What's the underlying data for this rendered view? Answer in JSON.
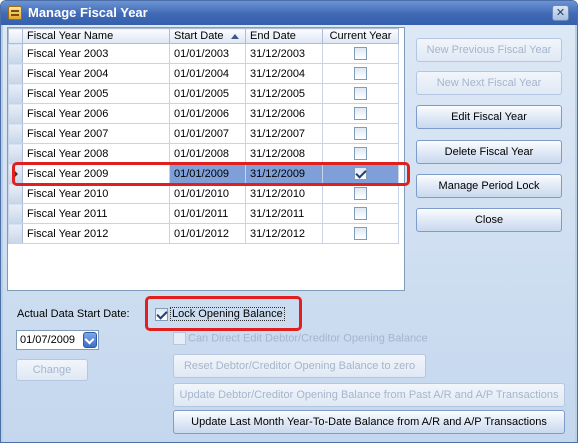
{
  "window": {
    "title": "Manage Fiscal Year",
    "close_glyph": "✕"
  },
  "grid": {
    "columns": [
      "Fiscal Year Name",
      "Start Date",
      "End Date",
      "Current Year"
    ],
    "rows": [
      {
        "name": "Fiscal Year 2003",
        "start": "01/01/2003",
        "end": "31/12/2003",
        "current": false
      },
      {
        "name": "Fiscal Year 2004",
        "start": "01/01/2004",
        "end": "31/12/2004",
        "current": false
      },
      {
        "name": "Fiscal Year 2005",
        "start": "01/01/2005",
        "end": "31/12/2005",
        "current": false
      },
      {
        "name": "Fiscal Year 2006",
        "start": "01/01/2006",
        "end": "31/12/2006",
        "current": false
      },
      {
        "name": "Fiscal Year 2007",
        "start": "01/01/2007",
        "end": "31/12/2007",
        "current": false
      },
      {
        "name": "Fiscal Year 2008",
        "start": "01/01/2008",
        "end": "31/12/2008",
        "current": false
      },
      {
        "name": "Fiscal Year 2009",
        "start": "01/01/2009",
        "end": "31/12/2009",
        "current": true
      },
      {
        "name": "Fiscal Year 2010",
        "start": "01/01/2010",
        "end": "31/12/2010",
        "current": false
      },
      {
        "name": "Fiscal Year 2011",
        "start": "01/01/2011",
        "end": "31/12/2011",
        "current": false
      },
      {
        "name": "Fiscal Year 2012",
        "start": "01/01/2012",
        "end": "31/12/2012",
        "current": false
      }
    ],
    "selected_row_index": 6
  },
  "buttons": {
    "new_previous": "New Previous Fiscal Year",
    "new_next": "New Next Fiscal Year",
    "edit": "Edit Fiscal Year",
    "delete": "Delete Fiscal Year",
    "manage_lock": "Manage Period Lock",
    "close": "Close",
    "change": "Change",
    "reset_balance": "Reset Debtor/Creditor Opening Balance to zero",
    "update_past": "Update Debtor/Creditor Opening Balance from Past A/R and A/P Transactions",
    "update_last_month": "Update Last Month Year-To-Date Balance from A/R and A/P Transactions"
  },
  "bottom": {
    "actual_start_label": "Actual Data Start Date:",
    "actual_start_value": "01/07/2009",
    "lock_opening_label": "Lock Opening Balance",
    "lock_opening_checked": true,
    "can_direct_edit_label": "Can Direct Edit Debtor/Creditor Opening Balance",
    "can_direct_edit_checked": false
  },
  "colors": {
    "title_bar": "#3f69b4",
    "selected_row": "#7f9fd8",
    "highlight": "#e01f1f"
  }
}
